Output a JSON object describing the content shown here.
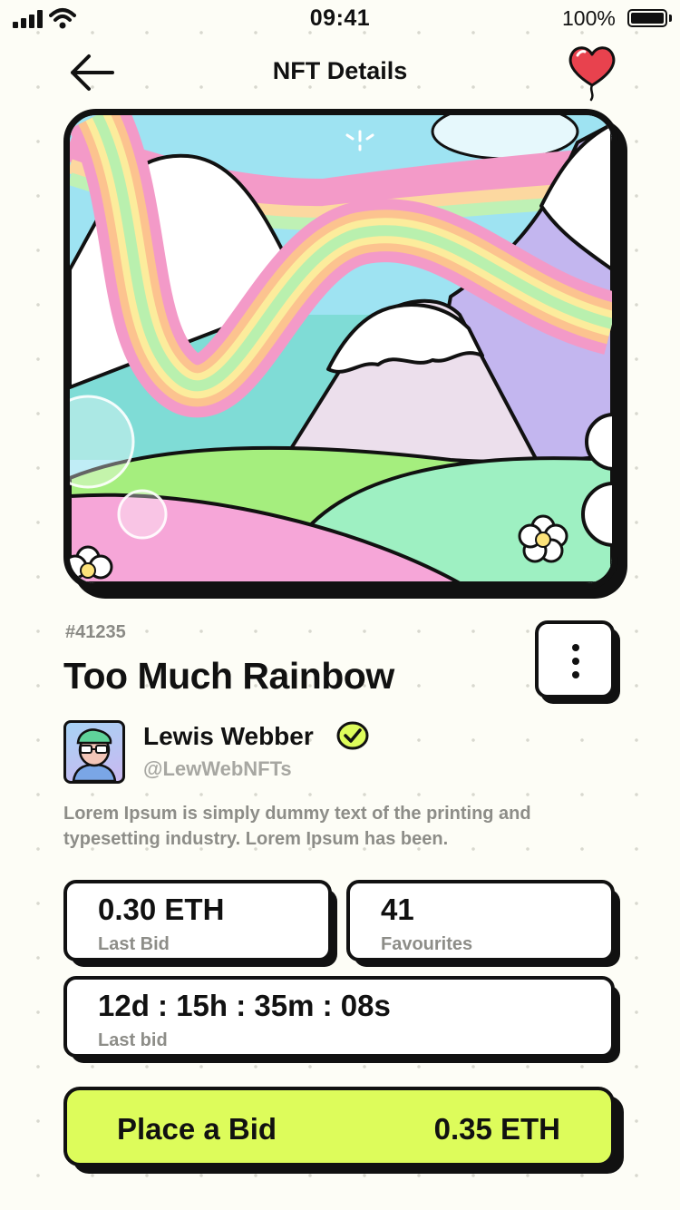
{
  "status_bar": {
    "time": "09:41",
    "battery": "100%"
  },
  "header": {
    "title": "NFT Details"
  },
  "nft": {
    "token_id": "#41235",
    "title": "Too Much Rainbow",
    "creator_name": "Lewis Webber",
    "creator_handle": "@LewWebNFTs",
    "description": "Lorem Ipsum is simply dummy text of the printing and typesetting industry. Lorem Ipsum has been."
  },
  "stats": {
    "last_bid_value": "0.30 ETH",
    "last_bid_label": "Last Bid",
    "favourites_value": "41",
    "favourites_label": "Favourites",
    "countdown_value": "12d : 15h : 35m : 08s",
    "countdown_label": "Last bid"
  },
  "action": {
    "label": "Place a Bid",
    "price": "0.35 ETH"
  },
  "icons": {
    "back": "arrow-left-icon",
    "favorite": "heart-balloon-icon",
    "more": "more-vertical-icon",
    "verified": "verified-check-icon"
  },
  "colors": {
    "accent": "#ddfc5b",
    "background": "#fdfdf6",
    "verified": "#ddfc5b",
    "heart": "#e8424e"
  }
}
